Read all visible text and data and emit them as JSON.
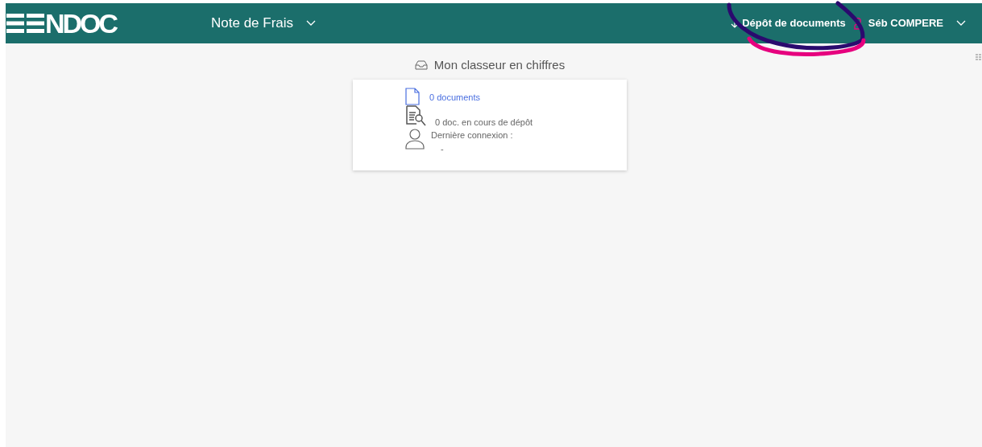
{
  "header": {
    "logo": "NDOC",
    "app_menu": {
      "label": "Note de Frais"
    },
    "upload_link": {
      "label": "Dépôt de documents"
    },
    "user_menu": {
      "label": "Séb COMPERE"
    }
  },
  "panel": {
    "title": "Mon classeur en chiffres",
    "stats": [
      {
        "kind": "documents",
        "text": "0 documents"
      },
      {
        "kind": "pending",
        "text": "0 doc. en cours de dépôt"
      },
      {
        "kind": "connection",
        "text": "Dernière connexion :",
        "value": "-"
      }
    ]
  }
}
